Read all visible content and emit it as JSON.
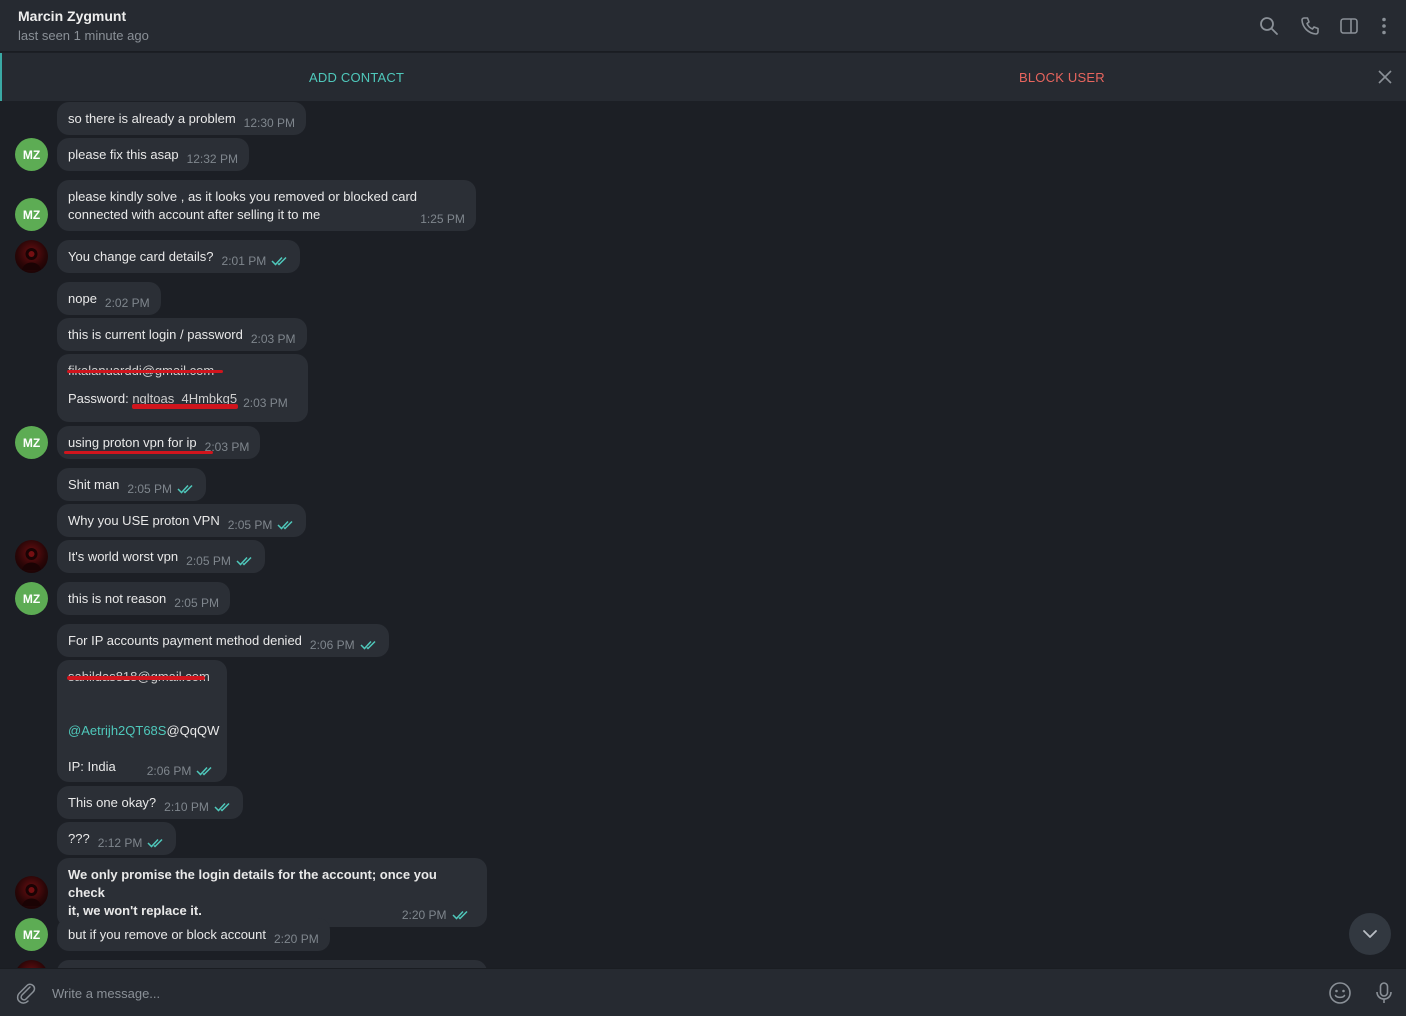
{
  "header": {
    "contact_name": "Marcin Zygmunt",
    "status": "last seen 1 minute ago",
    "icons": [
      "search-icon",
      "phone-icon",
      "sidebar-icon",
      "more-icon"
    ]
  },
  "action_bar": {
    "add_contact": "ADD CONTACT",
    "block_user": "BLOCK USER"
  },
  "avatar_initials": "MZ",
  "messages": [
    {
      "text": "so there is already a problem",
      "time": "12:30 PM"
    },
    {
      "text": "please fix this asap",
      "time": "12:32 PM"
    },
    {
      "line1": "please kindly solve , as it looks you removed or blocked card",
      "line2": "connected with account after selling it to me",
      "time": "1:25 PM"
    },
    {
      "text": "You change card details?",
      "time": "2:01 PM"
    },
    {
      "text": "nope",
      "time": "2:02 PM"
    },
    {
      "text": "this is current login / password",
      "time": "2:03 PM"
    },
    {
      "line1": "fikalanuarddi@gmail.com",
      "label": "Password: ",
      "redacted": "ngltoas_4Hmbkg5",
      "time": "2:03 PM"
    },
    {
      "text": "using proton vpn for ip",
      "time": "2:03 PM"
    },
    {
      "text": "Shit man",
      "time": "2:05 PM"
    },
    {
      "text": "Why you USE proton VPN",
      "time": "2:05 PM"
    },
    {
      "text": "It's world worst vpn",
      "time": "2:05 PM"
    },
    {
      "text": "this is not reason",
      "time": "2:05 PM"
    },
    {
      "text": "For IP accounts payment method denied",
      "time": "2:06 PM"
    },
    {
      "line1": "sahildas818@gmail.com",
      "mention": "@Aetrijh2QT68S",
      "mention_rest": "@QqQW",
      "ip": "IP: India",
      "time": "2:06 PM"
    },
    {
      "text": "This one okay?",
      "time": "2:10 PM"
    },
    {
      "text": "???",
      "time": "2:12 PM"
    },
    {
      "line1": "We only promise the login details for the account; once you check",
      "line2": "it, we won't replace it.",
      "time": "2:20 PM"
    },
    {
      "text": "but if you remove or block account",
      "time": "2:20 PM"
    }
  ],
  "composer": {
    "placeholder": "Write a message..."
  },
  "colors": {
    "accent": "#4fc8bb",
    "danger": "#e8655e",
    "bubble": "#2b2f36",
    "background": "#1c1f25",
    "avatar_mz": "#5dac54"
  }
}
